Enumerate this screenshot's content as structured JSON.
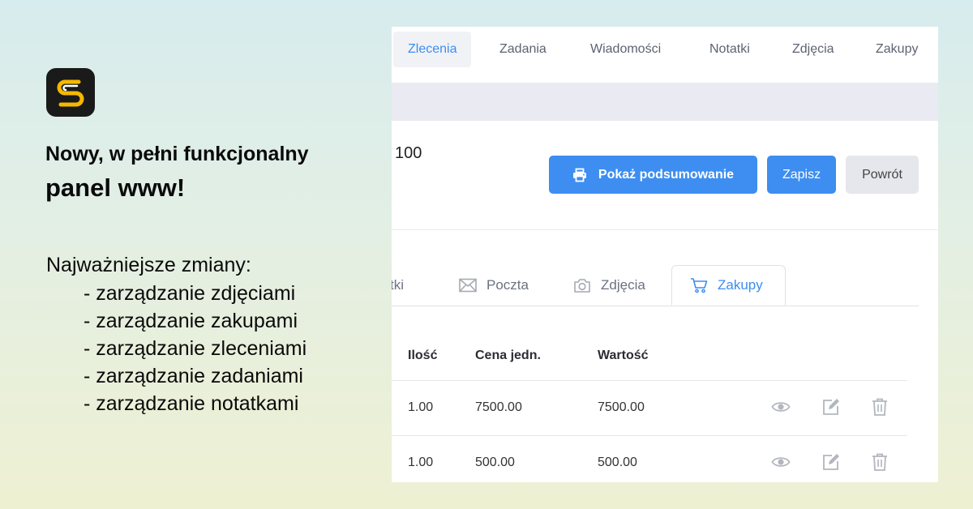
{
  "promo": {
    "headline_line1": "Nowy, w pełni funkcjonalny",
    "headline_line2": "panel www!",
    "changes_title": "Najważniejsze zmiany:",
    "changes": [
      "- zarządzanie zdjęciami",
      "- zarządzanie zakupami",
      "- zarządzanie zleceniami",
      "- zarządzanie zadaniami",
      "- zarządzanie notatkami"
    ]
  },
  "topnav": {
    "tabs": [
      "Zlecenia",
      "Zadania",
      "Wiadomości",
      "Notatki",
      "Zdjęcia",
      "Zakupy"
    ],
    "active": "Zlecenia"
  },
  "order": {
    "id_fragment": "100"
  },
  "actions": {
    "summary_label": "Pokaż podsumowanie",
    "save_label": "Zapisz",
    "back_label": "Powrót"
  },
  "subtabs": {
    "items": [
      "tki",
      "Poczta",
      "Zdjęcia",
      "Zakupy"
    ],
    "active": "Zakupy"
  },
  "purchases_table": {
    "columns": [
      "Ilość",
      "Cena jedn.",
      "Wartość"
    ],
    "rows": [
      {
        "qty": "1.00",
        "unit_price": "7500.00",
        "value": "7500.00"
      },
      {
        "qty": "1.00",
        "unit_price": "500.00",
        "value": "500.00"
      }
    ]
  },
  "colors": {
    "accent": "#3d8ef0",
    "logo_bg": "#1a1a1a",
    "logo_stroke": "#f5b800",
    "icon_gray": "#b3b6bd"
  },
  "icons": {
    "printer": "printer-icon",
    "mail": "mail-icon",
    "camera": "camera-icon",
    "cart": "cart-icon",
    "view": "eye-icon",
    "edit": "edit-icon",
    "delete": "trash-icon"
  }
}
